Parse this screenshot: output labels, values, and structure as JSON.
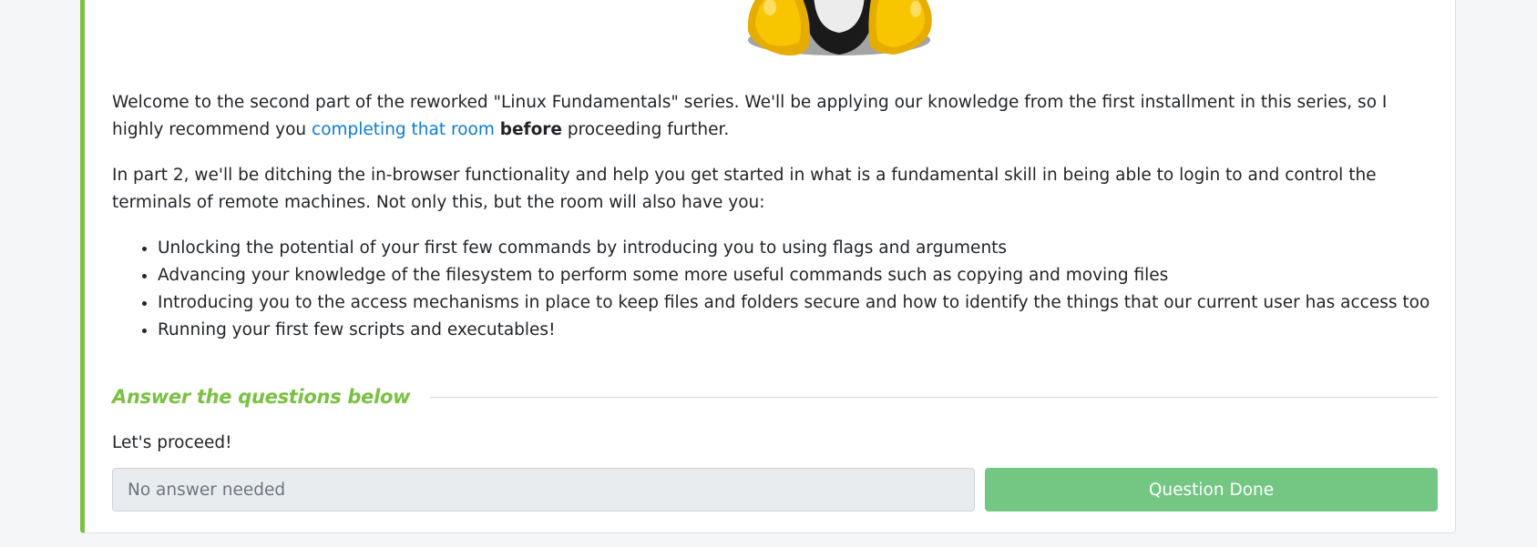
{
  "intro": {
    "p1_before_link": "Welcome to the second part of the reworked \"Linux Fundamentals\" series. We'll be applying our knowledge from the first installment in this series, so I highly recommend you ",
    "p1_link": "completing that room",
    "p1_bold": "before",
    "p1_after": " proceeding further.",
    "p2": "In part 2, we'll be ditching the in-browser functionality and help you get started in what is a fundamental skill in being able to login to and control the terminals of remote machines. Not only this, but the room will also have you:"
  },
  "bullets": [
    "Unlocking the potential of your first few commands by introducing you to using flags and arguments",
    "Advancing your knowledge of the filesystem to perform some more useful commands such as copying and moving files",
    "Introducing you to the access mechanisms in place to keep files and folders secure and how to identify the things that our current user has access too",
    "Running your first few scripts and executables!"
  ],
  "questions": {
    "heading": "Answer the questions below",
    "question_text": "Let's proceed!",
    "answer_placeholder": "No answer needed",
    "done_label": "Question Done"
  },
  "colors": {
    "accent_green": "#7ac143",
    "link_blue": "#0c7cd5",
    "done_button": "#74c683"
  },
  "icons": {
    "mascot": "tux-penguin-feet-icon"
  }
}
